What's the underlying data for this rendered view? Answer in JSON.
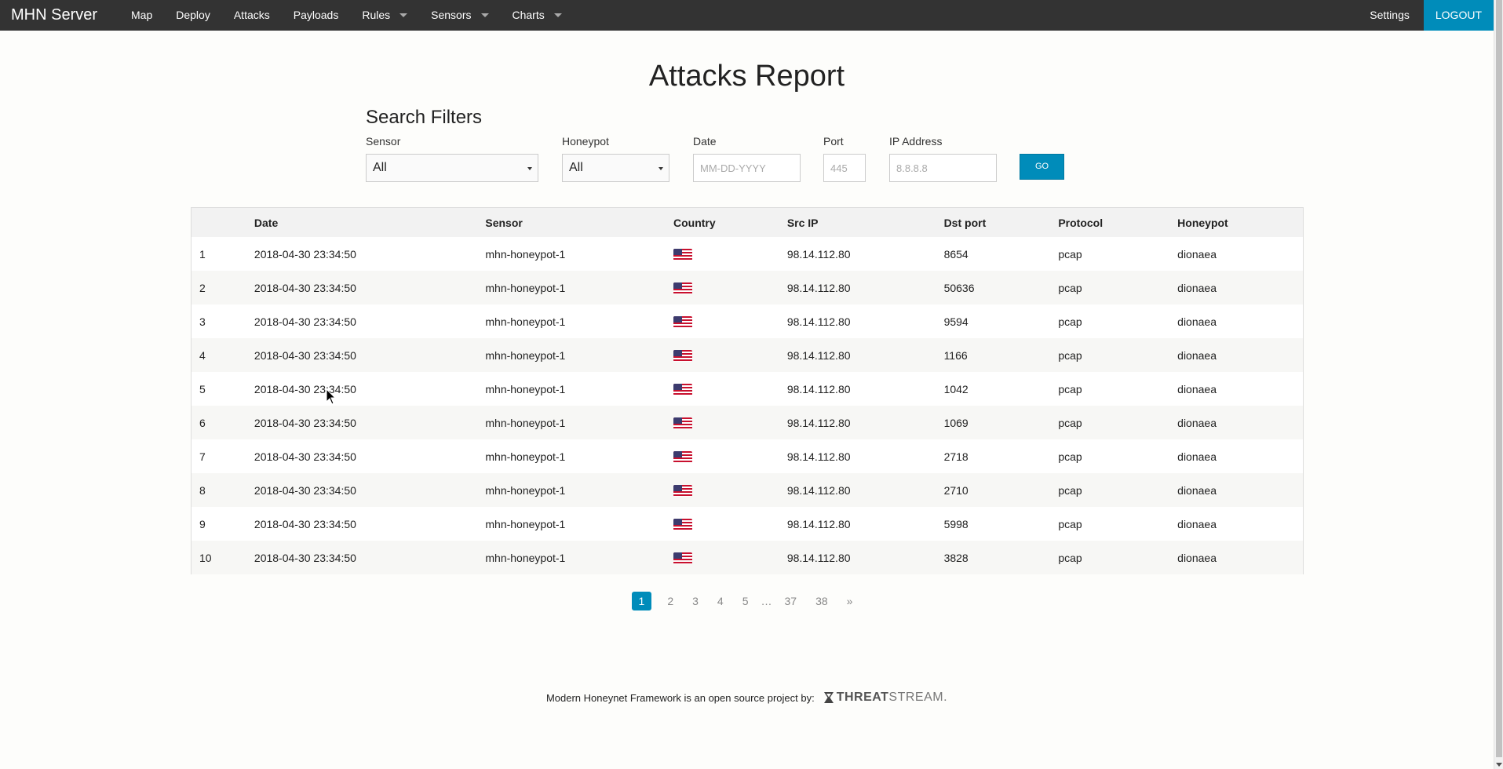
{
  "app": {
    "brand": "MHN Server"
  },
  "nav": {
    "items": [
      {
        "label": "Map",
        "dropdown": false
      },
      {
        "label": "Deploy",
        "dropdown": false
      },
      {
        "label": "Attacks",
        "dropdown": false
      },
      {
        "label": "Payloads",
        "dropdown": false
      },
      {
        "label": "Rules",
        "dropdown": true
      },
      {
        "label": "Sensors",
        "dropdown": true
      },
      {
        "label": "Charts",
        "dropdown": true
      }
    ],
    "settings": "Settings",
    "logout": "LOGOUT"
  },
  "page": {
    "title": "Attacks Report"
  },
  "filters": {
    "heading": "Search Filters",
    "sensor": {
      "label": "Sensor",
      "value": "All"
    },
    "honeypot": {
      "label": "Honeypot",
      "value": "All"
    },
    "date": {
      "label": "Date",
      "placeholder": "MM-DD-YYYY"
    },
    "port": {
      "label": "Port",
      "placeholder": "445"
    },
    "ip": {
      "label": "IP Address",
      "placeholder": "8.8.8.8"
    },
    "go": "GO"
  },
  "table": {
    "columns": [
      "",
      "Date",
      "Sensor",
      "Country",
      "Src IP",
      "Dst port",
      "Protocol",
      "Honeypot"
    ],
    "rows": [
      {
        "n": "1",
        "date": "2018-04-30 23:34:50",
        "sensor": "mhn-honeypot-1",
        "country": "us-flag-icon",
        "src_ip": "98.14.112.80",
        "dst_port": "8654",
        "protocol": "pcap",
        "honeypot": "dionaea"
      },
      {
        "n": "2",
        "date": "2018-04-30 23:34:50",
        "sensor": "mhn-honeypot-1",
        "country": "us-flag-icon",
        "src_ip": "98.14.112.80",
        "dst_port": "50636",
        "protocol": "pcap",
        "honeypot": "dionaea"
      },
      {
        "n": "3",
        "date": "2018-04-30 23:34:50",
        "sensor": "mhn-honeypot-1",
        "country": "us-flag-icon",
        "src_ip": "98.14.112.80",
        "dst_port": "9594",
        "protocol": "pcap",
        "honeypot": "dionaea"
      },
      {
        "n": "4",
        "date": "2018-04-30 23:34:50",
        "sensor": "mhn-honeypot-1",
        "country": "us-flag-icon",
        "src_ip": "98.14.112.80",
        "dst_port": "1166",
        "protocol": "pcap",
        "honeypot": "dionaea"
      },
      {
        "n": "5",
        "date": "2018-04-30 23:34:50",
        "sensor": "mhn-honeypot-1",
        "country": "us-flag-icon",
        "src_ip": "98.14.112.80",
        "dst_port": "1042",
        "protocol": "pcap",
        "honeypot": "dionaea"
      },
      {
        "n": "6",
        "date": "2018-04-30 23:34:50",
        "sensor": "mhn-honeypot-1",
        "country": "us-flag-icon",
        "src_ip": "98.14.112.80",
        "dst_port": "1069",
        "protocol": "pcap",
        "honeypot": "dionaea"
      },
      {
        "n": "7",
        "date": "2018-04-30 23:34:50",
        "sensor": "mhn-honeypot-1",
        "country": "us-flag-icon",
        "src_ip": "98.14.112.80",
        "dst_port": "2718",
        "protocol": "pcap",
        "honeypot": "dionaea"
      },
      {
        "n": "8",
        "date": "2018-04-30 23:34:50",
        "sensor": "mhn-honeypot-1",
        "country": "us-flag-icon",
        "src_ip": "98.14.112.80",
        "dst_port": "2710",
        "protocol": "pcap",
        "honeypot": "dionaea"
      },
      {
        "n": "9",
        "date": "2018-04-30 23:34:50",
        "sensor": "mhn-honeypot-1",
        "country": "us-flag-icon",
        "src_ip": "98.14.112.80",
        "dst_port": "5998",
        "protocol": "pcap",
        "honeypot": "dionaea"
      },
      {
        "n": "10",
        "date": "2018-04-30 23:34:50",
        "sensor": "mhn-honeypot-1",
        "country": "us-flag-icon",
        "src_ip": "98.14.112.80",
        "dst_port": "3828",
        "protocol": "pcap",
        "honeypot": "dionaea"
      }
    ]
  },
  "pagination": {
    "active": "1",
    "pages": [
      "2",
      "3",
      "4",
      "5"
    ],
    "ellipsis": "…",
    "tail_pages": [
      "37",
      "38"
    ],
    "next": "»"
  },
  "footer": {
    "text": "Modern Honeynet Framework is an open source project by:",
    "logo_bold": "THREAT",
    "logo_thin": "STREAM."
  },
  "colors": {
    "navbar": "#333333",
    "accent": "#008cba",
    "background": "#fdfdfb"
  }
}
